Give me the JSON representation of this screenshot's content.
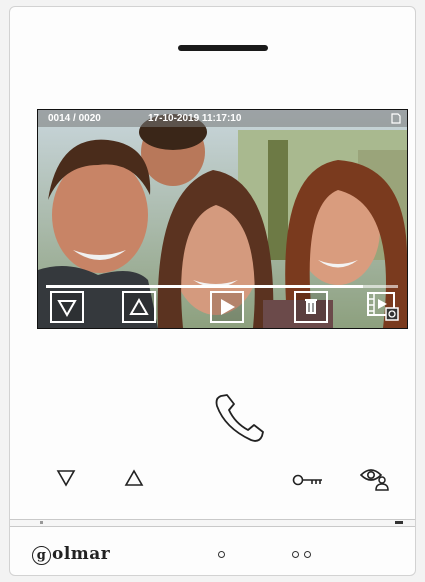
{
  "screen": {
    "status": {
      "counter": "0014 / 0020",
      "datetime": "17-10-2019  11:17:10",
      "sd_icon": "sd-card-icon"
    },
    "playback_progress": 0.9,
    "toolbar": [
      {
        "name": "previous-button",
        "icon": "triangle-down-icon"
      },
      {
        "name": "next-button",
        "icon": "triangle-up-icon"
      },
      {
        "name": "play-button",
        "icon": "play-icon"
      },
      {
        "name": "delete-button",
        "icon": "trash-icon"
      },
      {
        "name": "gallery-button",
        "icon": "photo-video-mode-icon"
      }
    ]
  },
  "hardware_buttons": {
    "call": "handset-icon",
    "down": "triangle-down-icon",
    "up": "triangle-up-icon",
    "door": "key-icon",
    "monitor": "eye-user-icon"
  },
  "brand": {
    "initial": "g",
    "rest": "olmar"
  },
  "indicators": {
    "single": "1 dot",
    "double": "2 dots"
  },
  "colors": {
    "panel": "#fdfdfd",
    "screen_bar": "#787878",
    "icon_stroke": "#222222"
  }
}
